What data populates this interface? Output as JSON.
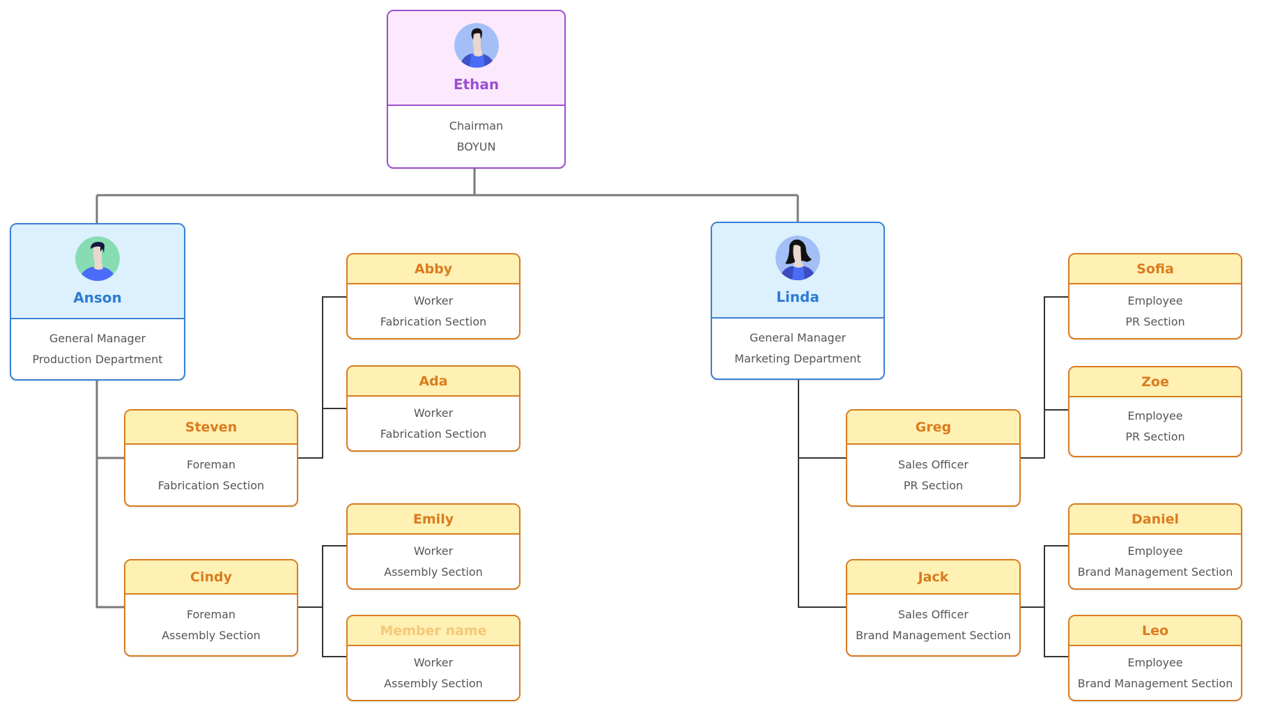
{
  "chart": {
    "root": {
      "name": "Ethan",
      "title": "Chairman",
      "unit": "BOYUN",
      "avatar": "male-avatar-icon",
      "theme_color": "#9a4fd0"
    },
    "managers": [
      {
        "name": "Anson",
        "title": "General Manager",
        "unit": "Production Department",
        "avatar": "male-avatar-icon",
        "theme_color": "#2f7bd3",
        "foremen": [
          {
            "name": "Steven",
            "title": "Foreman",
            "unit": "Fabrication Section",
            "workers": [
              {
                "name": "Abby",
                "title": "Worker",
                "unit": "Fabrication Section"
              },
              {
                "name": "Ada",
                "title": "Worker",
                "unit": "Fabrication Section"
              }
            ]
          },
          {
            "name": "Cindy",
            "title": "Foreman",
            "unit": "Assembly Section",
            "workers": [
              {
                "name": "Emily",
                "title": "Worker",
                "unit": "Assembly Section"
              },
              {
                "name": "Member name",
                "title": "Worker",
                "unit": "Assembly Section",
                "placeholder": true
              }
            ]
          }
        ]
      },
      {
        "name": "Linda",
        "title": "General Manager",
        "unit": "Marketing Department",
        "avatar": "female-avatar-icon",
        "theme_color": "#2f7bd3",
        "foremen": [
          {
            "name": "Greg",
            "title": "Sales Officer",
            "unit": "PR Section",
            "workers": [
              {
                "name": "Sofia",
                "title": "Employee",
                "unit": "PR Section"
              },
              {
                "name": "Zoe",
                "title": "Employee",
                "unit": "PR Section"
              }
            ]
          },
          {
            "name": "Jack",
            "title": "Sales Officer",
            "unit": "Brand Management Section",
            "workers": [
              {
                "name": "Daniel",
                "title": "Employee",
                "unit": "Brand Management Section"
              },
              {
                "name": "Leo",
                "title": "Employee",
                "unit": "Brand Management Section"
              }
            ]
          }
        ]
      }
    ],
    "colors": {
      "staff_border": "#d97c1f",
      "staff_header": "#fff0b3",
      "manager_header": "#dcf1fd",
      "root_header": "#fde9fd"
    }
  }
}
